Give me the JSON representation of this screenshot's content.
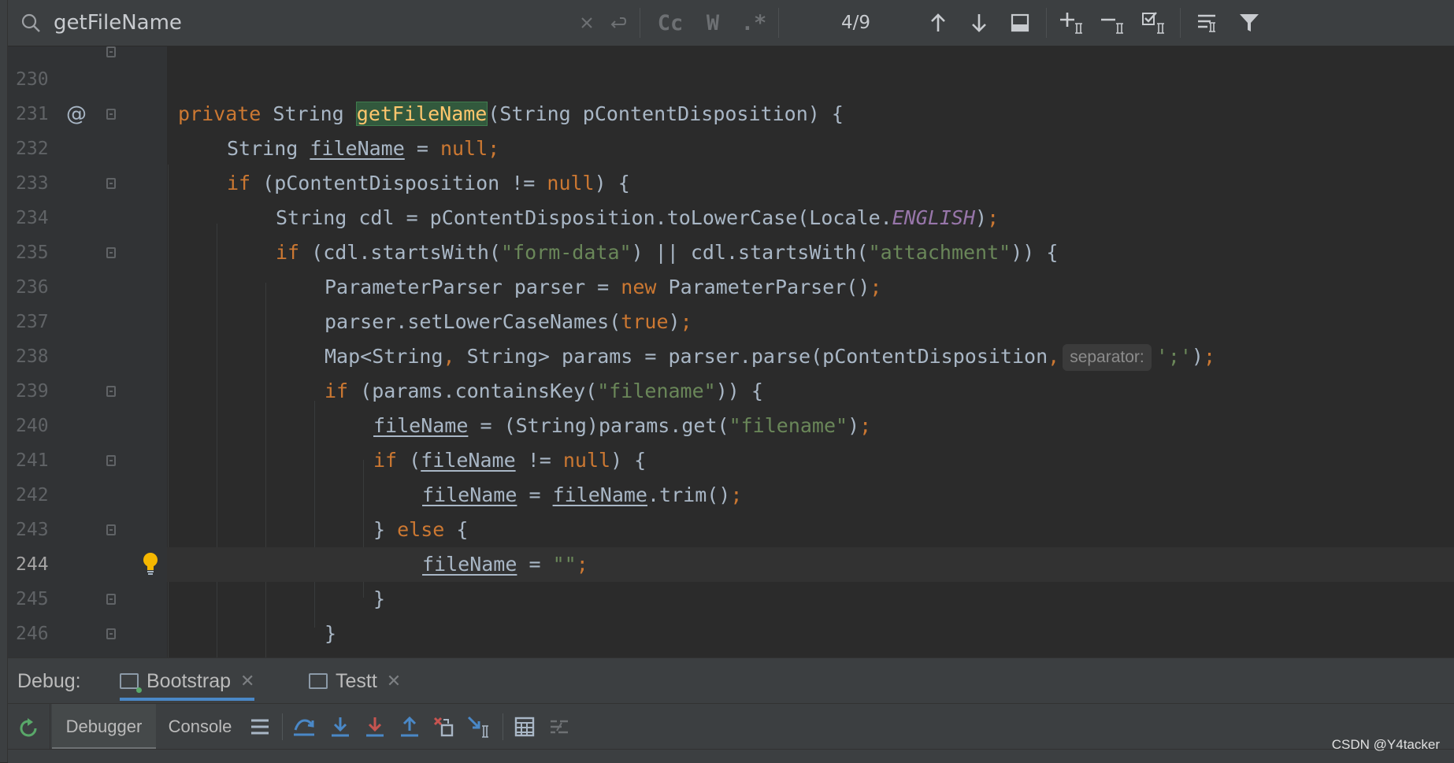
{
  "search": {
    "query": "getFileName",
    "match_count": "4/9",
    "case_label": "Cc",
    "words_label": "W",
    "regex_label": ".*"
  },
  "editor": {
    "current_line": "244",
    "lines": [
      {
        "num": "230"
      },
      {
        "num": "231",
        "text": "private String getFileName(String pContentDisposition) {"
      },
      {
        "num": "232",
        "text": "String fileName = null;"
      },
      {
        "num": "233",
        "text": "if (pContentDisposition != null) {"
      },
      {
        "num": "234",
        "text": "String cdl = pContentDisposition.toLowerCase(Locale.ENGLISH);"
      },
      {
        "num": "235",
        "text": "if (cdl.startsWith(\"form-data\") || cdl.startsWith(\"attachment\")) {"
      },
      {
        "num": "236",
        "text": "ParameterParser parser = new ParameterParser();"
      },
      {
        "num": "237",
        "text": "parser.setLowerCaseNames(true);"
      },
      {
        "num": "238",
        "text": "Map<String, String> params = parser.parse(pContentDisposition, ';');"
      },
      {
        "num": "239",
        "text": "if (params.containsKey(\"filename\")) {"
      },
      {
        "num": "240",
        "text": "fileName = (String)params.get(\"filename\");"
      },
      {
        "num": "241",
        "text": "if (fileName != null) {"
      },
      {
        "num": "242",
        "text": "fileName = fileName.trim();"
      },
      {
        "num": "243",
        "text": "} else {"
      },
      {
        "num": "244",
        "text": "fileName = \"\";"
      },
      {
        "num": "245",
        "text": "}"
      },
      {
        "num": "246",
        "text": "}"
      }
    ],
    "param_hint": "separator:"
  },
  "debug": {
    "label": "Debug:",
    "tabs": [
      {
        "label": "Bootstrap",
        "active": true
      },
      {
        "label": "Testt",
        "active": false
      }
    ],
    "subtabs": [
      {
        "label": "Debugger",
        "active": true
      },
      {
        "label": "Console",
        "active": false
      }
    ]
  },
  "watermark": "CSDN @Y4tacker",
  "colors": {
    "background": "#2b2b2b",
    "keyword": "#cc7832",
    "string": "#6a8759",
    "method": "#ffc66d",
    "constant": "#9876aa",
    "text": "#a9b7c6",
    "match_highlight": "#32593d"
  }
}
